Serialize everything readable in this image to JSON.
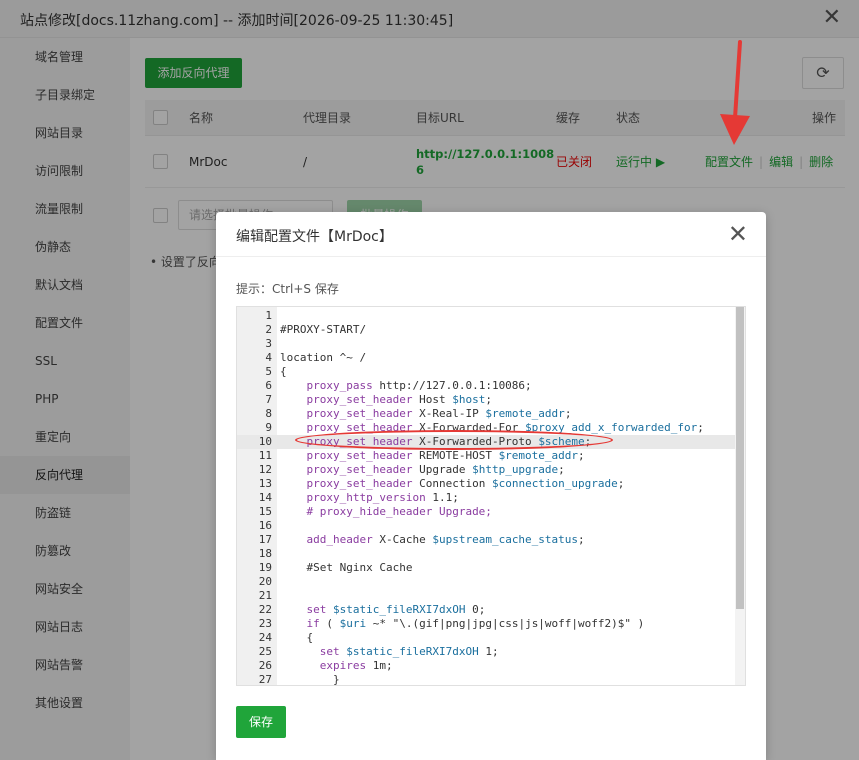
{
  "window": {
    "title": "站点修改[docs.11zhang.com] -- 添加时间[2026-09-25 11:30:45]",
    "close_glyph": "✕"
  },
  "sidebar": {
    "items": [
      {
        "label": "域名管理"
      },
      {
        "label": "子目录绑定"
      },
      {
        "label": "网站目录"
      },
      {
        "label": "访问限制"
      },
      {
        "label": "流量限制"
      },
      {
        "label": "伪静态"
      },
      {
        "label": "默认文档"
      },
      {
        "label": "配置文件"
      },
      {
        "label": "SSL"
      },
      {
        "label": "PHP"
      },
      {
        "label": "重定向"
      },
      {
        "label": "反向代理",
        "active": true
      },
      {
        "label": "防盗链"
      },
      {
        "label": "防篡改"
      },
      {
        "label": "网站安全"
      },
      {
        "label": "网站日志"
      },
      {
        "label": "网站告警"
      },
      {
        "label": "其他设置"
      }
    ]
  },
  "main": {
    "add_button": "添加反向代理",
    "refresh_glyph": "⟳",
    "table": {
      "headers": {
        "name": "名称",
        "proxy_dir": "代理目录",
        "target_url": "目标URL",
        "cache": "缓存",
        "status": "状态",
        "actions": "操作"
      },
      "rows": [
        {
          "name": "MrDoc",
          "proxy_dir": "/",
          "target_url_line1": "http://127.0.0.1:1008",
          "target_url_line2": "6",
          "cache": "已关闭",
          "status": "运行中 ▶",
          "action_config": "配置文件",
          "action_edit": "编辑",
          "action_delete": "删除",
          "separator": "|"
        }
      ]
    },
    "batch": {
      "select_placeholder": "请选择批量操作",
      "button": "批量操作"
    },
    "note": "• 设置了反向代理..."
  },
  "modal": {
    "title": "编辑配置文件【MrDoc】",
    "close_glyph": "✕",
    "hint": "提示：Ctrl+S 保存",
    "save_button": "保存",
    "highlighted_line": 10,
    "lines": [
      {
        "n": "1",
        "t": ""
      },
      {
        "n": "2",
        "t": "#PROXY-START/"
      },
      {
        "n": "3",
        "t": ""
      },
      {
        "n": "4",
        "t": "location ^~ /"
      },
      {
        "n": "5",
        "t": "{"
      },
      {
        "n": "6",
        "i": "    ",
        "k": "proxy_pass",
        "r": " http://127.0.0.1:10086;"
      },
      {
        "n": "7",
        "i": "    ",
        "k": "proxy_set_header",
        "r": " Host ",
        "v": "$host",
        "e": ";"
      },
      {
        "n": "8",
        "i": "    ",
        "k": "proxy_set_header",
        "r": " X-Real-IP ",
        "v": "$remote_addr",
        "e": ";"
      },
      {
        "n": "9",
        "i": "    ",
        "k": "proxy_set_header",
        "r": " X-Forwarded-For ",
        "v": "$proxy_add_x_forwarded_for",
        "e": ";"
      },
      {
        "n": "10",
        "i": "    ",
        "k": "proxy_set_header",
        "r": " X-Forwarded-Proto ",
        "v": "$scheme",
        "e": ";"
      },
      {
        "n": "11",
        "i": "    ",
        "k": "proxy_set_header",
        "r": " REMOTE-HOST ",
        "v": "$remote_addr",
        "e": ";"
      },
      {
        "n": "12",
        "i": "    ",
        "k": "proxy_set_header",
        "r": " Upgrade ",
        "v": "$http_upgrade",
        "e": ";"
      },
      {
        "n": "13",
        "i": "    ",
        "k": "proxy_set_header",
        "r": " Connection ",
        "v": "$connection_upgrade",
        "e": ";"
      },
      {
        "n": "14",
        "i": "    ",
        "k": "proxy_http_version",
        "r": " 1.1;"
      },
      {
        "n": "15",
        "i": "    ",
        "r": "# proxy_hide_header Upgrade;",
        "kc": true
      },
      {
        "n": "16",
        "t": ""
      },
      {
        "n": "17",
        "i": "    ",
        "k": "add_header",
        "r": " X-Cache ",
        "v": "$upstream_cache_status",
        "e": ";",
        "kd": true
      },
      {
        "n": "18",
        "t": ""
      },
      {
        "n": "19",
        "i": "    ",
        "r": "#Set Nginx Cache"
      },
      {
        "n": "20",
        "t": ""
      },
      {
        "n": "21",
        "t": ""
      },
      {
        "n": "22",
        "i": "    ",
        "k": "set",
        "r": " ",
        "v": "$static_fileRXI7dxOH",
        "e": " 0;",
        "kd": true
      },
      {
        "n": "23",
        "i": "    ",
        "k": "if",
        "r": " ( ",
        "v": "$uri",
        "e": " ~* \"\\.(gif|png|jpg|css|js|woff|woff2)$\" )",
        "kd": true
      },
      {
        "n": "24",
        "i": "    ",
        "r": "{"
      },
      {
        "n": "25",
        "i": "      ",
        "k": "set",
        "r": " ",
        "v": "$static_fileRXI7dxOH",
        "e": " 1;",
        "kd": true
      },
      {
        "n": "26",
        "i": "      ",
        "k": "expires",
        "r": " 1m;",
        "kd": true
      },
      {
        "n": "27",
        "i": "        ",
        "r": "}"
      }
    ]
  },
  "colors": {
    "accent": "#20a53a",
    "danger": "#ef0808",
    "annotation": "#e53935"
  }
}
